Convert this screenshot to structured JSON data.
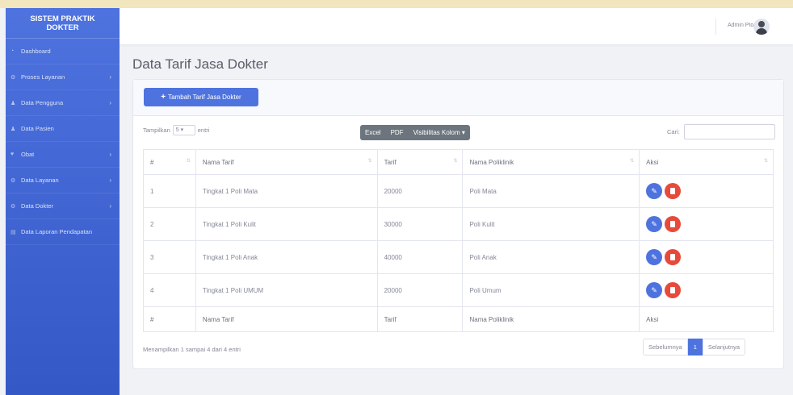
{
  "sidebar": {
    "brand": "SISTEM PRAKTIK DOKTER",
    "items": [
      {
        "label": "Dashboard",
        "icon": "dashboard-icon",
        "has_chevron": false
      },
      {
        "label": "Proses Layanan",
        "icon": "cog-icon",
        "has_chevron": true
      },
      {
        "label": "Data Pengguna",
        "icon": "user-icon",
        "has_chevron": true
      },
      {
        "label": "Data Pasien",
        "icon": "user-icon",
        "has_chevron": false
      },
      {
        "label": "Obat",
        "icon": "heart-icon",
        "has_chevron": true
      },
      {
        "label": "Data Layanan",
        "icon": "cog-icon",
        "has_chevron": true
      },
      {
        "label": "Data Dokter",
        "icon": "cog-icon",
        "has_chevron": true
      },
      {
        "label": "Data Laporan Pendapatan",
        "icon": "file-icon",
        "has_chevron": false
      }
    ]
  },
  "topbar": {
    "username": "Admin Pto"
  },
  "page": {
    "title": "Data Tarif Jasa Dokter"
  },
  "card": {
    "add_button": "Tambah Tarif Jasa Dokter",
    "length": {
      "prefix": "Tampilkan",
      "value": "5",
      "suffix": "entri"
    },
    "buttons": [
      "Excel",
      "PDF",
      "Visibilitas Kolom"
    ],
    "search_label": "Cari:",
    "columns": [
      "#",
      "Nama Tarif",
      "Tarif",
      "Nama Poliklinik",
      "Aksi"
    ],
    "rows": [
      {
        "no": "1",
        "nama_tarif": "Tingkat 1 Poli Mata",
        "tarif": "20000",
        "poliklinik": "Poli Mata"
      },
      {
        "no": "2",
        "nama_tarif": "Tingkat 1 Poli Kulit",
        "tarif": "30000",
        "poliklinik": "Poli Kulit"
      },
      {
        "no": "3",
        "nama_tarif": "Tingkat 1 Poli Anak",
        "tarif": "40000",
        "poliklinik": "Poli Anak"
      },
      {
        "no": "4",
        "nama_tarif": "Tingkat 1 Poli UMUM",
        "tarif": "20000",
        "poliklinik": "Poli Umum"
      }
    ],
    "info": "Menampilkan 1 sampai 4 dari 4 entri",
    "pager": {
      "prev": "Sebelumnya",
      "current": "1",
      "next": "Selanjutnya"
    }
  },
  "colors": {
    "primary": "#4e73df",
    "danger": "#e74a3b",
    "secondary": "#6c757d"
  }
}
